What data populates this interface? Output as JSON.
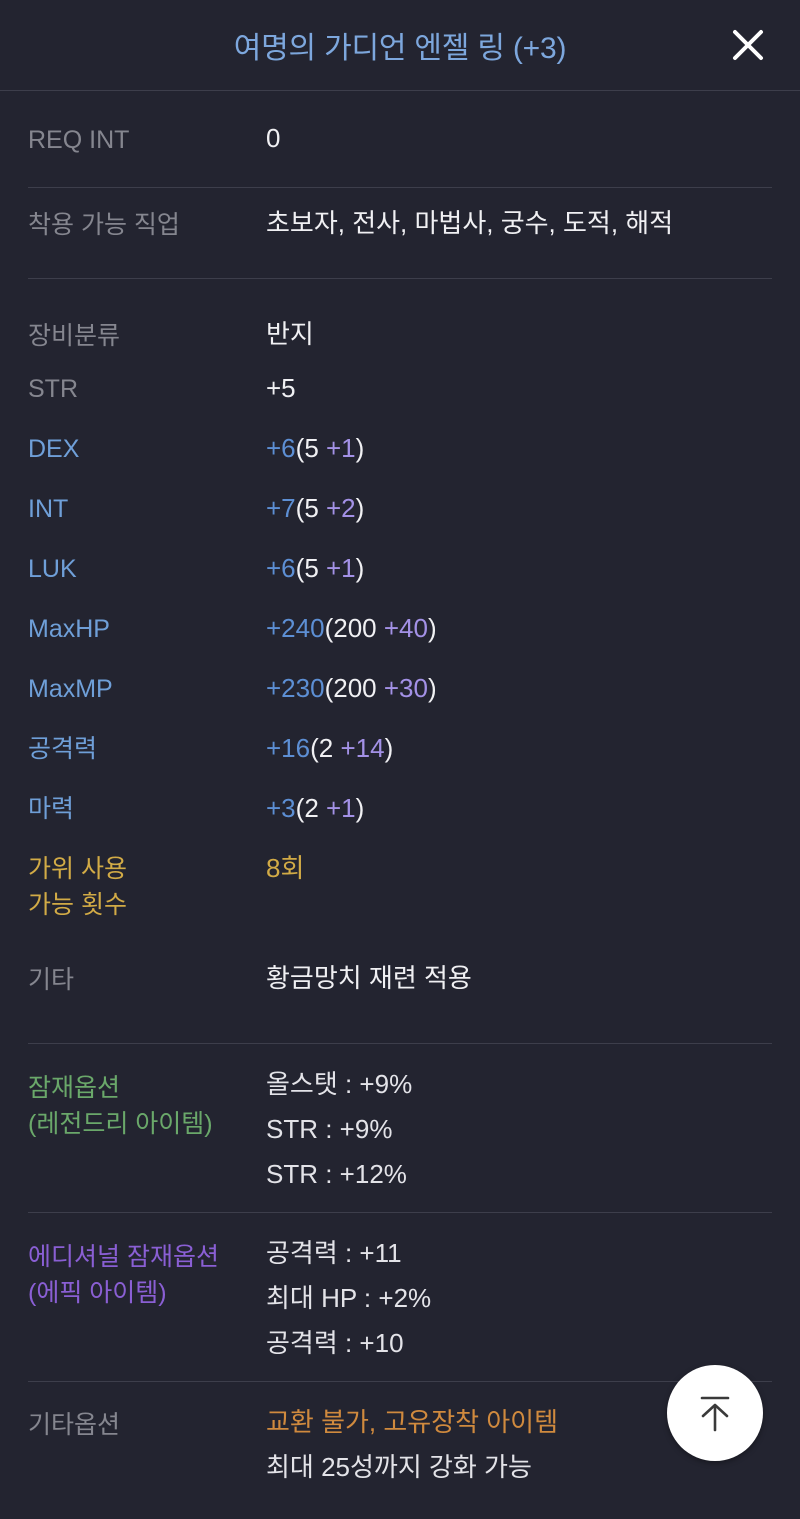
{
  "header": {
    "title": "여명의 가디언 엔젤 링 (+3)",
    "close_icon": "close-icon"
  },
  "rows": {
    "req_int": {
      "label": "REQ INT",
      "value": "0"
    },
    "jobs": {
      "label": "착용 가능 직업",
      "value": "초보자, 전사, 마법사, 궁수, 도적, 해적"
    },
    "equip_type": {
      "label": "장비분류",
      "value": "반지"
    },
    "str": {
      "label": "STR",
      "value": "+5"
    },
    "dex": {
      "label": "DEX",
      "bonus": "+6",
      "base_open": "(5 ",
      "increment": "+1",
      "close": ")"
    },
    "int": {
      "label": "INT",
      "bonus": "+7",
      "base_open": "(5 ",
      "increment": "+2",
      "close": ")"
    },
    "luk": {
      "label": "LUK",
      "bonus": "+6",
      "base_open": "(5 ",
      "increment": "+1",
      "close": ")"
    },
    "maxhp": {
      "label": "MaxHP",
      "bonus": "+240",
      "base_open": "(200 ",
      "increment": "+40",
      "close": ")"
    },
    "maxmp": {
      "label": "MaxMP",
      "bonus": "+230",
      "base_open": "(200 ",
      "increment": "+30",
      "close": ")"
    },
    "attack": {
      "label": "공격력",
      "bonus": "+16",
      "base_open": "(2 ",
      "increment": "+14",
      "close": ")"
    },
    "magic": {
      "label": "마력",
      "bonus": "+3",
      "base_open": "(2 ",
      "increment": "+1",
      "close": ")"
    },
    "scissors": {
      "label": "가위 사용\n가능 횟수",
      "value": "8회"
    },
    "etc": {
      "label": "기타",
      "value": "황금망치 재련 적용"
    },
    "potential": {
      "label": "잠재옵션\n(레전드리 아이템)",
      "lines": [
        "올스탯 : +9%",
        "STR : +9%",
        "STR : +12%"
      ]
    },
    "additional_potential": {
      "label": "에디셔널 잠재옵션\n(에픽 아이템)",
      "lines": [
        "공격력 : +11",
        "최대 HP : +2%",
        "공격력 : +10"
      ]
    },
    "etc_options": {
      "label": "기타옵션",
      "line_orange": "교환 불가, 고유장착 아이템",
      "line_plain": "최대 25성까지 강화 가능"
    }
  },
  "fab": {
    "icon": "scroll-to-top-icon"
  },
  "colors": {
    "background": "#232430",
    "divider": "#3d3e4b",
    "title_blue": "#7da7dd",
    "label_gray": "#85868f",
    "label_blue": "#6f9fd8",
    "gold": "#d2ab46",
    "green": "#6aa86a",
    "purple": "#8a5fd4",
    "orange": "#d08a3e",
    "value_white": "#f0f0f3",
    "bonus_blue": "#5d8fd4",
    "increment_purple": "#a391e6"
  }
}
